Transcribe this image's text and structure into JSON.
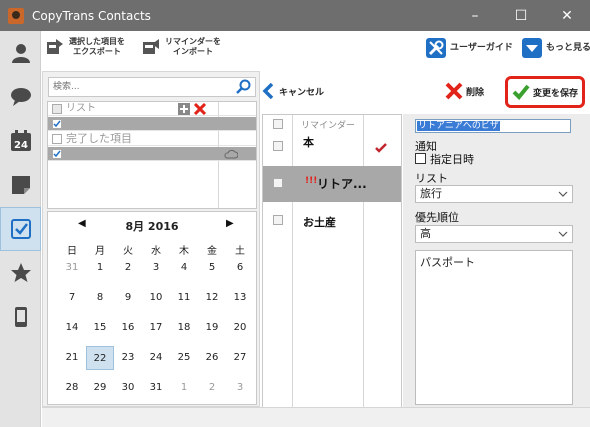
{
  "window": {
    "title": "CopyTrans Contacts"
  },
  "sidebar": {
    "items": [
      {
        "icon": "person-icon"
      },
      {
        "icon": "chat-bubble-icon"
      },
      {
        "icon": "calendar-icon",
        "date_number": "24"
      },
      {
        "icon": "note-icon"
      },
      {
        "icon": "checkbox-task-icon",
        "active": true
      },
      {
        "icon": "star-icon"
      },
      {
        "icon": "phone-icon"
      }
    ]
  },
  "toolbar": {
    "export_selected": "選択した項目を\nエクスポート",
    "import_reminders": "リマインダーを\nインポート",
    "user_guide": "ユーザーガイド",
    "see_more": "もっと見る"
  },
  "left": {
    "search_placeholder": "検索...",
    "list_rows": [
      {
        "label": "リスト"
      },
      {
        "label": ""
      },
      {
        "label": "完了した項目"
      },
      {
        "label": ""
      }
    ]
  },
  "calendar": {
    "month_label": "8月 2016",
    "weekdays": [
      "日",
      "月",
      "火",
      "水",
      "木",
      "金",
      "土"
    ],
    "weeks": [
      [
        "31",
        "1",
        "2",
        "3",
        "4",
        "5",
        "6"
      ],
      [
        "7",
        "8",
        "9",
        "10",
        "11",
        "12",
        "13"
      ],
      [
        "14",
        "15",
        "16",
        "17",
        "18",
        "19",
        "20"
      ],
      [
        "21",
        "22",
        "23",
        "24",
        "25",
        "26",
        "27"
      ],
      [
        "28",
        "29",
        "30",
        "31",
        "1",
        "2",
        "3"
      ]
    ],
    "today": "22"
  },
  "middle": {
    "cancel_label": "キャンセル",
    "column_header": "リマインダー",
    "tasks": [
      {
        "title": "本",
        "done": true,
        "priority": ""
      },
      {
        "title": "リトア...",
        "done": false,
        "priority": "!!!"
      },
      {
        "title": "お土産",
        "done": false,
        "priority": ""
      }
    ]
  },
  "right": {
    "delete_label": "削除",
    "save_label": "変更を保存",
    "title_value": "リトアニアへのビザ",
    "notify_label": "通知",
    "specified_date_label": "指定日時",
    "list_label": "リスト",
    "list_value": "旅行",
    "priority_label": "優先順位",
    "priority_value": "高",
    "notes_value": "パスポート"
  },
  "colors": {
    "titlebar": "#6e6e6e",
    "accent_blue": "#1f6fc5",
    "delete_red": "#e2231a",
    "save_ring": "#e2231a",
    "save_check": "#3aa12f",
    "selection_gray": "#a8a8a8",
    "active_blue": "#cfe1ef"
  }
}
